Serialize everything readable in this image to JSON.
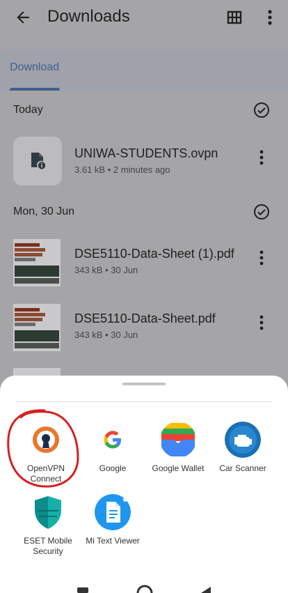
{
  "header": {
    "title": "Downloads",
    "back_icon": "arrow-left-icon",
    "grid_icon": "grid-view-icon",
    "more_icon": "more-vert-icon"
  },
  "tabs": [
    {
      "label": "Download",
      "active": true
    }
  ],
  "sections": [
    {
      "heading": "Today",
      "files": [
        {
          "name": "UNIWA-STUDENTS.ovpn",
          "meta": "3.61 kB • 2 minutes ago",
          "thumb_icon": "file-info-icon"
        }
      ]
    },
    {
      "heading": "Mon, 30 Jun",
      "files": [
        {
          "name": "DSE5110-Data-Sheet (1).pdf",
          "meta": "343 kB • 30 Jun",
          "thumb_icon": "pdf-preview"
        },
        {
          "name": "DSE5110-Data-Sheet.pdf",
          "meta": "343 kB • 30 Jun",
          "thumb_icon": "pdf-preview"
        }
      ]
    }
  ],
  "share_sheet": {
    "apps": [
      {
        "label": "OpenVPN\nConnect",
        "icon": "openvpn-icon"
      },
      {
        "label": "Google",
        "icon": "google-icon"
      },
      {
        "label": "Google Wallet",
        "icon": "google-wallet-icon"
      },
      {
        "label": "Car Scanner",
        "icon": "car-scanner-icon"
      },
      {
        "label": "ESET Mobile\nSecurity",
        "icon": "eset-icon"
      },
      {
        "label": "Mi Text Viewer",
        "icon": "mi-text-viewer-icon"
      }
    ]
  },
  "colors": {
    "accent": "#3f5d8f",
    "highlight": "#d42020",
    "openvpn_orange": "#e8772e",
    "car_scanner_blue": "#1b6fb3"
  }
}
